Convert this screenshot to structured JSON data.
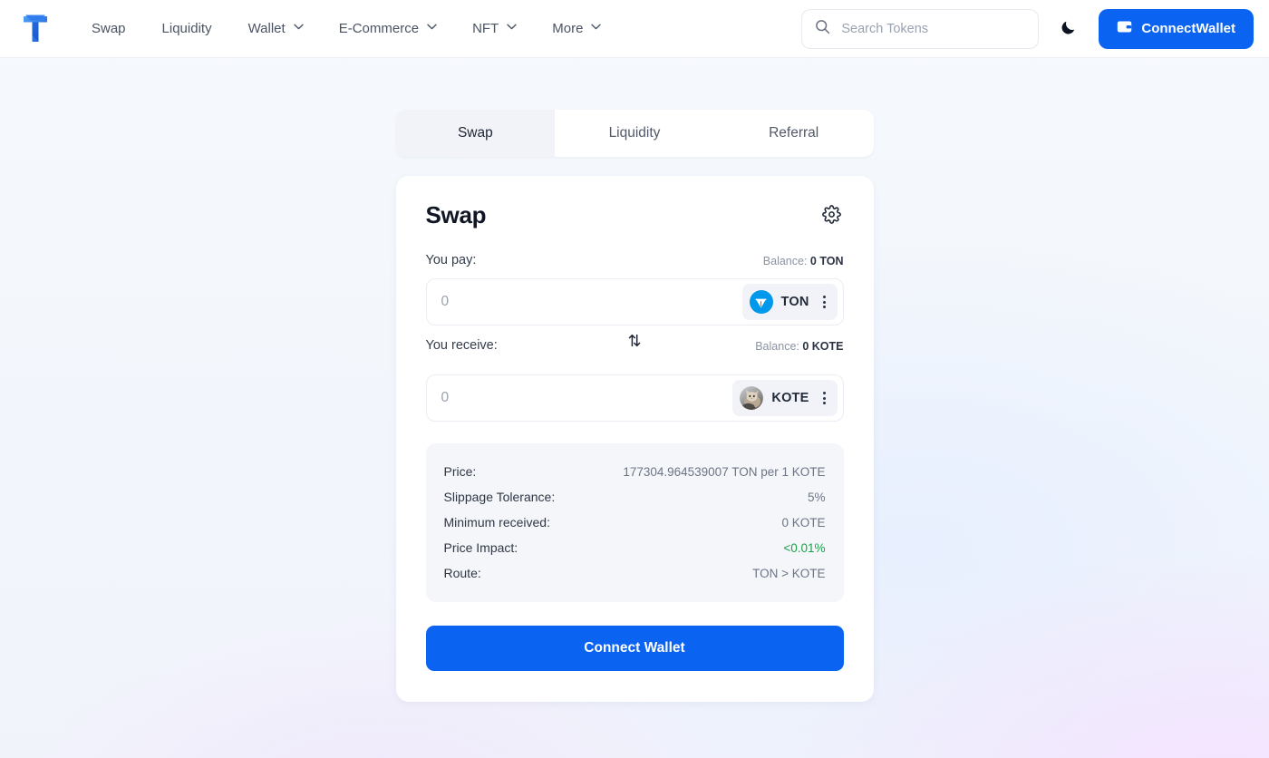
{
  "header": {
    "logo_alt": "ton-logo",
    "nav": [
      {
        "label": "Swap",
        "has_dropdown": false
      },
      {
        "label": "Liquidity",
        "has_dropdown": false
      },
      {
        "label": "Wallet",
        "has_dropdown": true
      },
      {
        "label": "E-Commerce",
        "has_dropdown": true
      },
      {
        "label": "NFT",
        "has_dropdown": true
      },
      {
        "label": "More",
        "has_dropdown": true
      }
    ],
    "search": {
      "placeholder": "Search Tokens",
      "value": "",
      "icon": "search-icon"
    },
    "theme_toggle_icon": "moon-icon",
    "connect_button": {
      "label": "ConnectWallet",
      "icon": "wallet-icon",
      "color": "#0a63f1"
    }
  },
  "tabs": {
    "items": [
      {
        "label": "Swap",
        "active": true
      },
      {
        "label": "Liquidity",
        "active": false
      },
      {
        "label": "Referral",
        "active": false
      }
    ]
  },
  "swap_card": {
    "title": "Swap",
    "settings_icon": "gear-icon",
    "pay": {
      "label": "You pay:",
      "balance_prefix": "Balance: ",
      "balance_value": "0 TON",
      "amount_value": "",
      "amount_placeholder": "0",
      "token_symbol": "TON",
      "token_icon": "ton-coin-icon",
      "token_icon_color": "#0098ea",
      "menu_icon": "kebab-menu-icon"
    },
    "switch_icon": "⇅",
    "receive": {
      "label": "You receive:",
      "balance_prefix": "Balance: ",
      "balance_value": "0 KOTE",
      "amount_value": "",
      "amount_placeholder": "0",
      "token_symbol": "KOTE",
      "token_icon": "kote-cat-avatar-icon",
      "menu_icon": "kebab-menu-icon"
    },
    "details": [
      {
        "key": "Price:",
        "value": "177304.964539007 TON per 1 KOTE",
        "highlight": false
      },
      {
        "key": "Slippage Tolerance:",
        "value": "5%",
        "highlight": false
      },
      {
        "key": "Minimum received:",
        "value": "0 KOTE",
        "highlight": false
      },
      {
        "key": "Price Impact:",
        "value": "<0.01%",
        "highlight": true
      },
      {
        "key": "Route:",
        "value": "TON > KOTE",
        "highlight": false
      }
    ],
    "cta_label": "Connect Wallet",
    "accent_color": "#0a63f1",
    "positive_color": "#17a34a"
  }
}
